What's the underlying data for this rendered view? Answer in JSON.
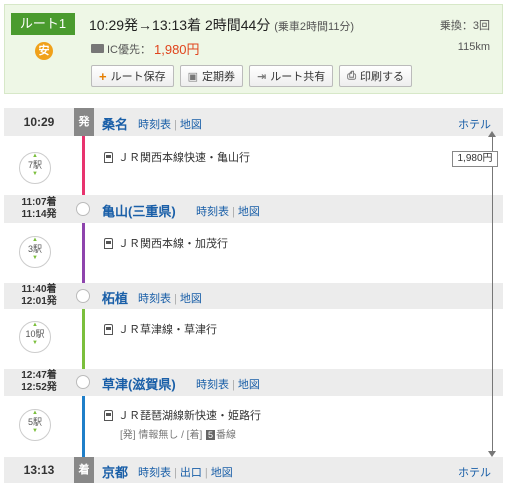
{
  "summary": {
    "route_label": "ルート1",
    "safe_label": "安",
    "depart": "10:29発",
    "arrow": "→",
    "arrive": "13:13着",
    "duration": "2時間44分",
    "ride_time": "(乗車2時間11分)",
    "transfers": "乗換：3回",
    "ic_label": "IC優先：",
    "fare": "1,980円",
    "distance": "115km",
    "buttons": {
      "save": "ルート保存",
      "pass": "定期券",
      "share": "ルート共有",
      "print": "印刷する"
    }
  },
  "stations": [
    {
      "time": "10:29",
      "mark": "発",
      "name": "桑名",
      "links": [
        "時刻表",
        "地図"
      ],
      "hotel": "ホテル"
    },
    {
      "arr": "11:07着",
      "dep": "11:14発",
      "name": "亀山(三重県)",
      "links": [
        "時刻表",
        "地図"
      ]
    },
    {
      "arr": "11:40着",
      "dep": "12:01発",
      "name": "柘植",
      "links": [
        "時刻表",
        "地図"
      ]
    },
    {
      "arr": "12:47着",
      "dep": "12:52発",
      "name": "草津(滋賀県)",
      "links": [
        "時刻表",
        "地図"
      ]
    },
    {
      "time": "13:13",
      "mark": "着",
      "name": "京都",
      "links": [
        "時刻表",
        "出口",
        "地図"
      ],
      "hotel": "ホテル"
    }
  ],
  "segments": [
    {
      "stops": "7駅",
      "train": "ＪＲ関西本線快速・亀山行",
      "color": "#e8336e"
    },
    {
      "stops": "3駅",
      "train": "ＪＲ関西本線・加茂行",
      "color": "#8e44ad"
    },
    {
      "stops": "10駅",
      "train": "ＪＲ草津線・草津行",
      "color": "#7bbf3c"
    },
    {
      "stops": "5駅",
      "train": "ＪＲ琵琶湖線新快速・姫路行",
      "color": "#1f7fc9",
      "platform_pre": "[発] 情報無し / [着]",
      "platform_num": "5",
      "platform_post": "番線"
    }
  ],
  "fare_total": "1,980円"
}
